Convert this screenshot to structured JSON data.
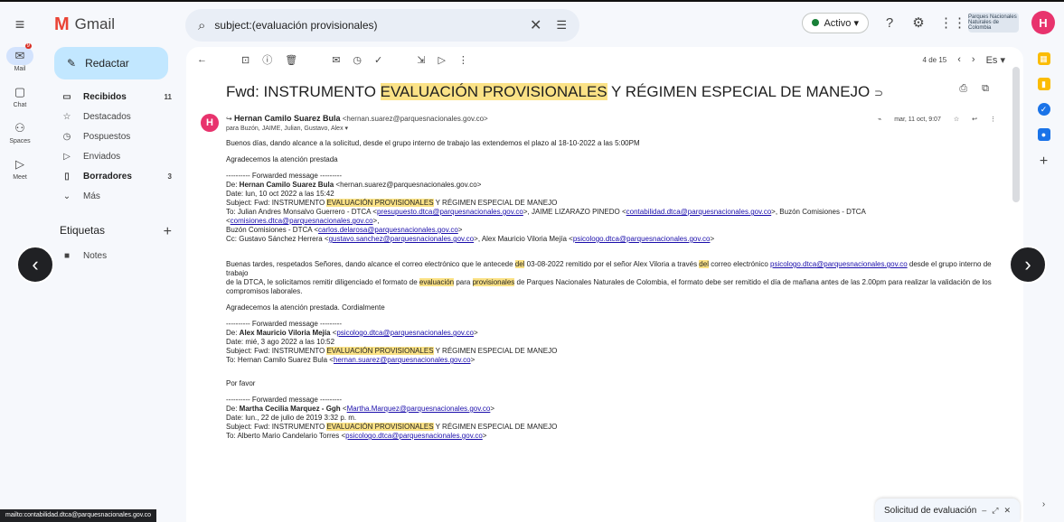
{
  "app": {
    "name": "Gmail"
  },
  "search": {
    "value": "subject:(evaluación provisionales)"
  },
  "header": {
    "status": "Activo ▾",
    "org_logo_text": "Parques Nacionales Naturales de Colombia",
    "avatar": "H"
  },
  "rail": {
    "mail": "Mail",
    "chat": "Chat",
    "spaces": "Spaces",
    "meet": "Meet"
  },
  "sidebar": {
    "compose": "Redactar",
    "items": [
      {
        "label": "Recibidos",
        "count": "11"
      },
      {
        "label": "Destacados",
        "count": ""
      },
      {
        "label": "Pospuestos",
        "count": ""
      },
      {
        "label": "Enviados",
        "count": ""
      },
      {
        "label": "Borradores",
        "count": "3"
      },
      {
        "label": "Más",
        "count": ""
      }
    ],
    "labels_title": "Etiquetas",
    "labels": [
      "Notes"
    ]
  },
  "toolbar": {
    "page": "4 de 15",
    "lang": "Es ▾"
  },
  "message": {
    "subject_pre": "Fwd: INSTRUMENTO ",
    "subject_hl": "EVALUACIÓN PROVISIONALES",
    "subject_post": " Y RÉGIMEN ESPECIAL DE MANEJO",
    "avatar": "H",
    "from_name": "Hernan Camilo Suarez Bula",
    "from_email": "<hernan.suarez@parquesnacionales.gov.co>",
    "to": "para Buzón, JAIME, Julian, Gustavo, Alex ▾",
    "date": "mar, 11 oct, 9:07"
  },
  "body": {
    "p1": "Buenos días, dando alcance a la solicitud, desde el grupo interno de trabajo las extendemos el plazo al 18-10-2022 a las 5:00PM",
    "p2": "Agradecemos la atención prestada",
    "fw1_head": "---------- Forwarded message ---------",
    "fw1_de_label": "De: ",
    "fw1_de_name": "Hernan Camilo Suarez Bula",
    "fw1_de_email": "<hernan.suarez@parquesnacionales.gov.co>",
    "fw1_date": "Date: lun, 10 oct 2022 a las 15:42",
    "fw1_subject_pre": "Subject: Fwd: INSTRUMENTO ",
    "fw1_subject_hl": "EVALUACIÓN PROVISIONALES",
    "fw1_subject_post": " Y RÉGIMEN ESPECIAL DE MANEJO",
    "fw1_to_a": "To: Julian Andres Monsalvo Guerrero - DTCA <",
    "fw1_to_l1": "presupuesto.dtca@parquesnacionales.gov.co",
    "fw1_to_b": ">, JAIME LIZARAZO PINEDO <",
    "fw1_to_l2": "contabilidad.dtca@parquesnacionales.gov.co",
    "fw1_to_c": ">, Buzón Comisiones - DTCA <",
    "fw1_to_l3": "comisiones.dtca@parquesnacionales.gov.co",
    "fw1_to_d": ">,",
    "fw1_to2_a": "Buzón Comisiones - DTCA <",
    "fw1_to2_l": "carlos.delarosa@parquesnacionales.gov.co",
    "fw1_to2_b": ">",
    "fw1_cc_a": "Cc: Gustavo Sánchez Herrera <",
    "fw1_cc_l1": "gustavo.sanchez@parquesnacionales.gov.co",
    "fw1_cc_b": ">, Alex Mauricio Viloria Mejía <",
    "fw1_cc_l2": "psicologo.dtca@parquesnacionales.gov.co",
    "fw1_cc_c": ">",
    "p3_a": "Buenas tardes, respetados Señores, dando alcance el correo electrónico que le antecede ",
    "p3_hl1": "del",
    "p3_b": " 03-08-2022 remitido por el señor Alex Viloria a través ",
    "p3_hl2": "del",
    "p3_c": " correo electrónico ",
    "p3_link": "psicologo.dtca@parquesnacionales.gov.co",
    "p3_d": " desde el grupo interno de trabajo",
    "p3_e": "de la DTCA, le solicitamos remitir diligenciado el formato de ",
    "p3_hl3": "evaluación",
    "p3_f": " para ",
    "p3_hl4": "provisionales",
    "p3_g": " de Parques Nacionales Naturales de Colombia, el formato debe ser remitido el día de mañana antes de las 2.00pm para realizar la validación de los",
    "p3_h": "compromisos laborales.",
    "p4": "Agradecemos la atención prestada. Cordialmente",
    "fw2_head": "---------- Forwarded message ---------",
    "fw2_de_label": "De: ",
    "fw2_de_name": "Alex Mauricio Viloria Mejía",
    "fw2_de_email": "psicologo.dtca@parquesnacionales.gov.co",
    "fw2_date": "Date: mié, 3 ago 2022 a las 10:52",
    "fw2_subject_pre": "Subject: Fwd: INSTRUMENTO ",
    "fw2_subject_hl": "EVALUACIÓN PROVISIONALES",
    "fw2_subject_post": " Y RÉGIMEN ESPECIAL DE MANEJO",
    "fw2_to_a": "To: Hernan Camilo Suarez Bula <",
    "fw2_to_l": "hernan.suarez@parquesnacionales.gov.co",
    "fw2_to_b": ">",
    "p5": "Por favor",
    "fw3_head": "---------- Forwarded message ---------",
    "fw3_de_label": "De: ",
    "fw3_de_name": "Martha Cecilia Marquez - Ggh",
    "fw3_de_email": "Martha.Marquez@parquesnacionales.gov.co",
    "fw3_date": "Date: lun., 22 de julio de 2019 3:32 p. m.",
    "fw3_subject_pre": "Subject: Fwd: INSTRUMENTO ",
    "fw3_subject_hl": "EVALUACIÓN PROVISIONALES",
    "fw3_subject_post": " Y RÉGIMEN ESPECIAL DE MANEJO",
    "fw3_to_a": "To: Alberto Mario Candelario Torres <",
    "fw3_to_l": "psicologo.dtca@parquesnacionales.gov.co",
    "fw3_to_b": ">"
  },
  "statusbar": {
    "url": "mailto:contabilidad.dtca@parquesnacionales.gov.co"
  },
  "minimized": {
    "title": "Solicitud de evaluación"
  },
  "colors": {
    "accent": "#c2e7ff",
    "highlight": "#fbe286",
    "avatar": "#e8336d",
    "link": "#1a0dab"
  }
}
